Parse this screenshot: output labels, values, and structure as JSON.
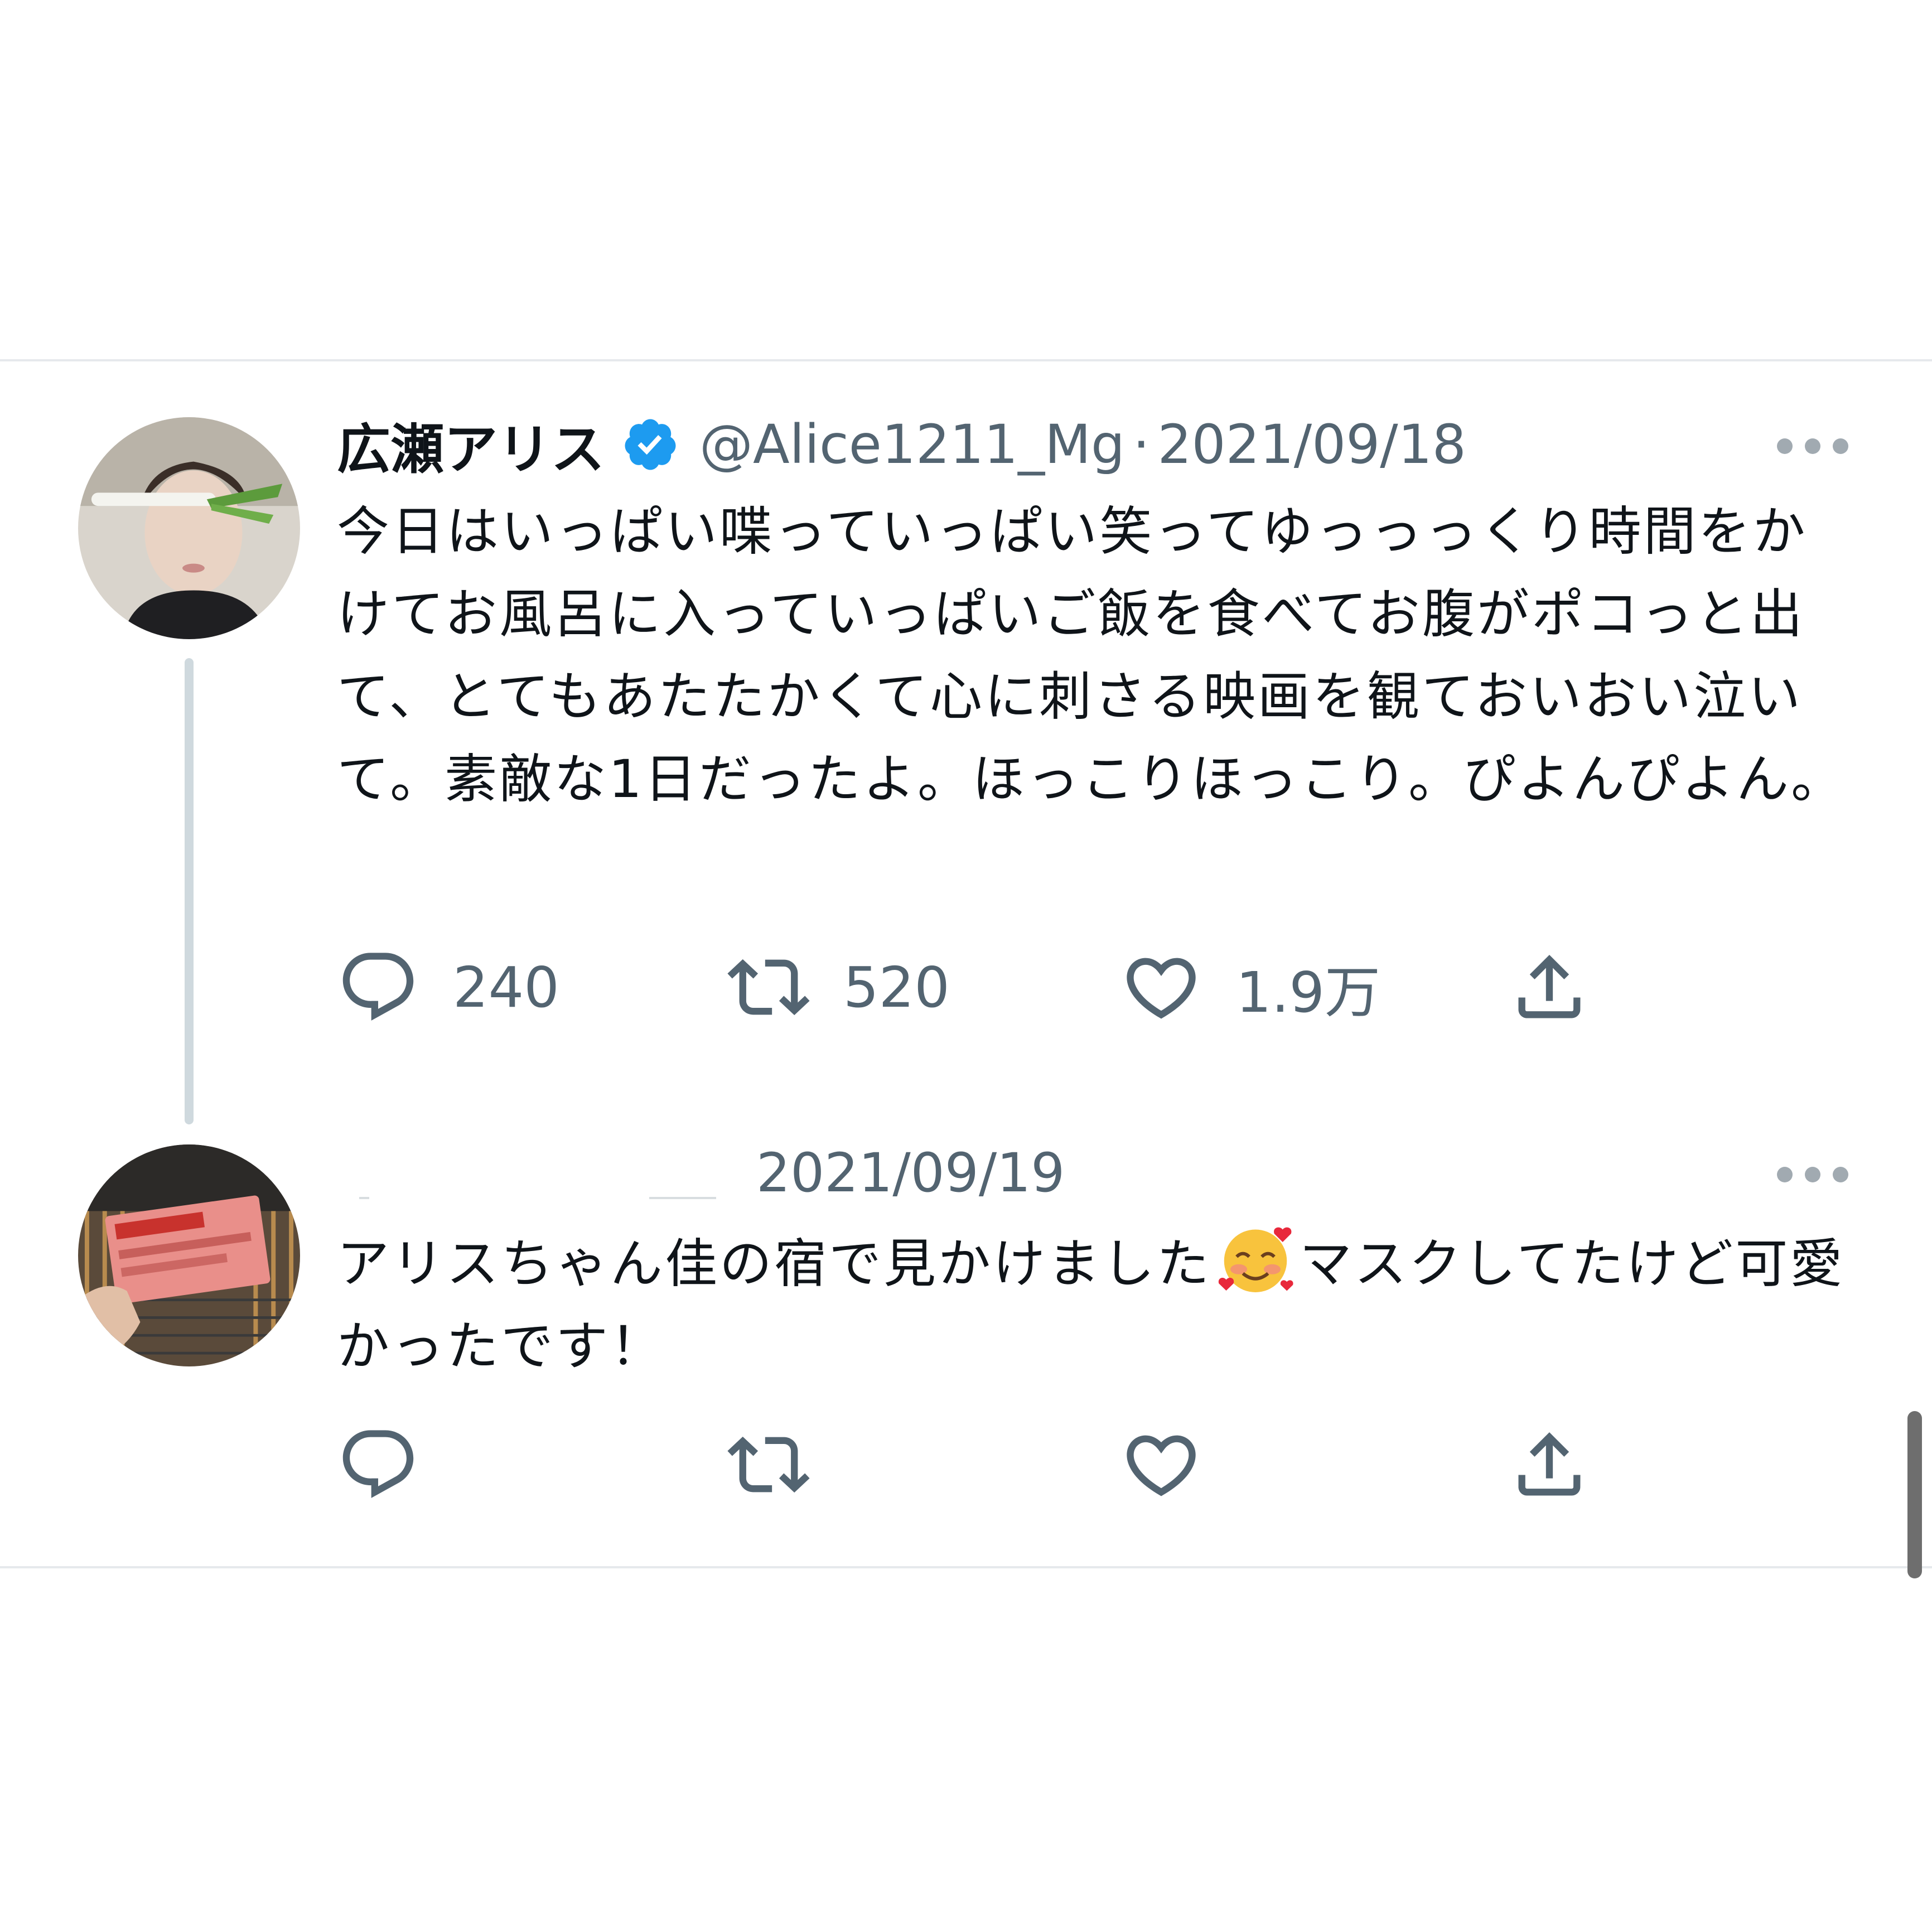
{
  "tweet1": {
    "display_name": "広瀬アリス",
    "handle": "@Alice1211_Mg",
    "separator": "·",
    "date": "2021/09/18",
    "text": "今日はいっぱい喋っていっぱい笑ってゆっっっくり時間をかけてお風呂に入っていっぱいご飯を食べてお腹がポコっと出て、とてもあたたかくて心に刺さる映画を観ておいおい泣いて。素敵な1日だったよ。ほっこりほっこり。ぴよんぴよん。",
    "reply_count": "240",
    "retweet_count": "520",
    "like_count": "1.9万"
  },
  "tweet2": {
    "date": "2021/09/19",
    "text_before_emoji": "アリスちゃん佳の宿で見かけました",
    "text_after_emoji": "マスクしてたけど可愛かったです！"
  },
  "icons": {
    "verified": "verified-badge-icon",
    "more": "more-dots-icon",
    "reply": "reply-icon",
    "retweet": "retweet-icon",
    "like": "heart-icon",
    "share": "share-icon",
    "emoji": "smiling-face-with-hearts-emoji"
  },
  "colors": {
    "primary_text": "#0f1419",
    "secondary_text": "#536471",
    "verified_blue": "#1d9bf0",
    "divider": "#e6e9ec",
    "thread_line": "#cfd9de"
  }
}
